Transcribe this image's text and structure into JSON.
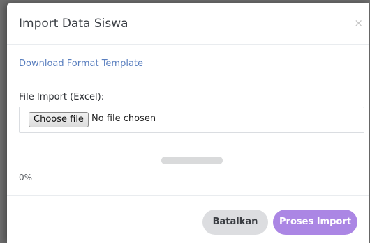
{
  "modal": {
    "title": "Import Data Siswa",
    "close_symbol": "×"
  },
  "body": {
    "download_link": "Download Format Template",
    "file_label": "File Import (Excel):",
    "choose_file_label": "Choose file",
    "no_file_text": "No file chosen",
    "progress_percent": 0,
    "progress_text": "0%"
  },
  "footer": {
    "cancel_label": "Batalkan",
    "import_label": "Proses Import"
  },
  "colors": {
    "primary": "#ab86e4",
    "link": "#5a7fbf",
    "secondary": "#dcdde0"
  }
}
